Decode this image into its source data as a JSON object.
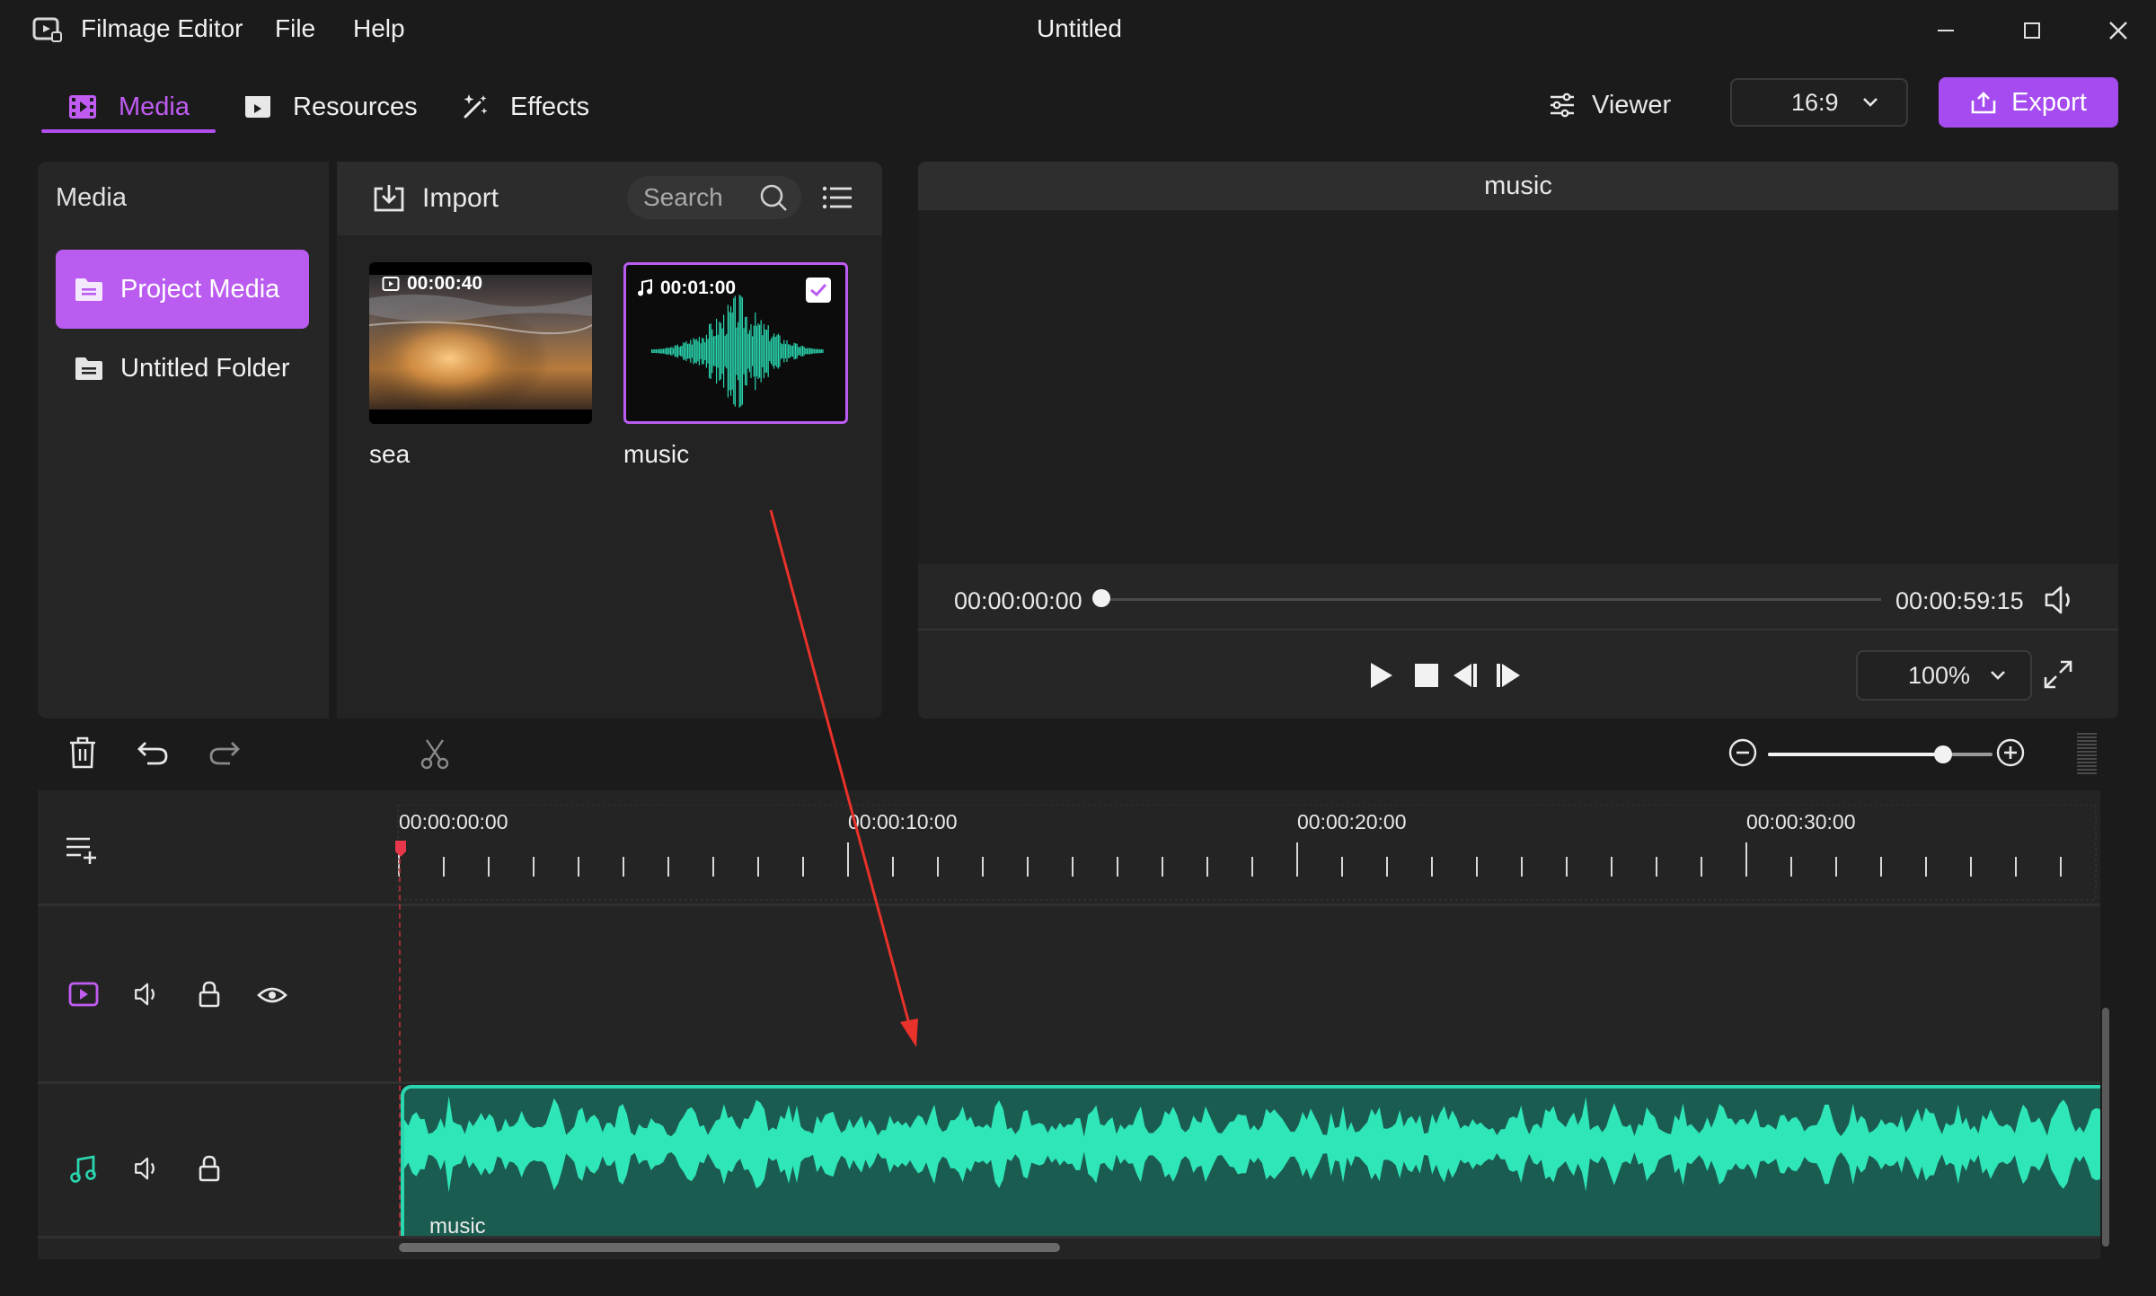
{
  "titlebar": {
    "app_name": "Filmage Editor",
    "menus": [
      "File",
      "Help"
    ],
    "document_title": "Untitled"
  },
  "tabs": [
    {
      "label": "Media",
      "icon": "film-icon",
      "active": true
    },
    {
      "label": "Resources",
      "icon": "play-box-icon",
      "active": false
    },
    {
      "label": "Effects",
      "icon": "sparkle-icon",
      "active": false
    }
  ],
  "header_right": {
    "viewer_label": "Viewer",
    "aspect_ratio": "16:9",
    "export_label": "Export"
  },
  "sidebar": {
    "title": "Media",
    "items": [
      {
        "label": "Project Media",
        "active": true
      },
      {
        "label": "Untitled Folder",
        "active": false
      }
    ]
  },
  "media_panel": {
    "import_label": "Import",
    "search_placeholder": "Search",
    "items": [
      {
        "name": "sea",
        "duration": "00:00:40",
        "type": "video",
        "selected": false
      },
      {
        "name": "music",
        "duration": "00:01:00",
        "type": "audio",
        "selected": true
      }
    ]
  },
  "viewer": {
    "title": "music",
    "current_time": "00:00:00:00",
    "end_time": "00:00:59:15",
    "zoom": "100%",
    "progress": 0
  },
  "timeline": {
    "ruler_labels": [
      "00:00:00:00",
      "00:00:10:00",
      "00:00:20:00",
      "00:00:30:00"
    ],
    "zoom_level": 0.78,
    "audio_clip_label": "music"
  },
  "colors": {
    "accent": "#b24df0",
    "audio_clip": "#1b5c50",
    "waveform": "#2ee6b8",
    "annotation_arrow": "#e8322a"
  }
}
